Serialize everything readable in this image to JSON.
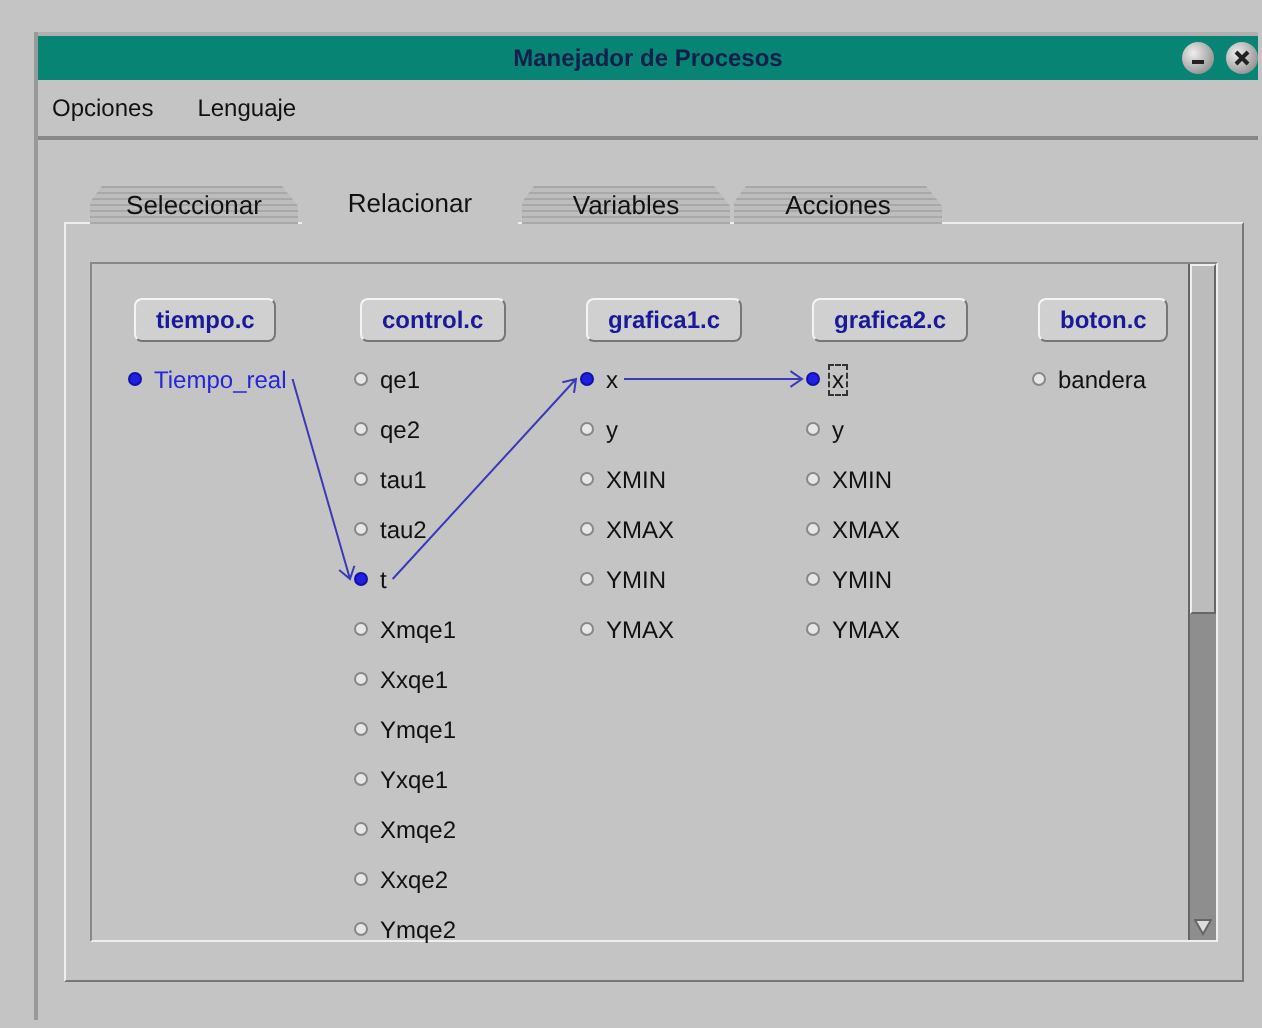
{
  "window": {
    "title": "Manejador de Procesos"
  },
  "menu": [
    "Opciones",
    "Lenguaje"
  ],
  "tabs": [
    {
      "label": "Seleccionar",
      "selected": false
    },
    {
      "label": "Relacionar",
      "selected": true
    },
    {
      "label": "Variables",
      "selected": false
    },
    {
      "label": "Acciones",
      "selected": false
    }
  ],
  "modules": [
    {
      "name": "tiempo.c",
      "variables": [
        {
          "name": "Tiempo_real",
          "connected": true,
          "selected": true,
          "focused": false,
          "links_out": true,
          "links_in": false
        }
      ]
    },
    {
      "name": "control.c",
      "variables": [
        {
          "name": "qe1",
          "connected": false,
          "selected": false,
          "focused": false
        },
        {
          "name": "qe2",
          "connected": false,
          "selected": false,
          "focused": false
        },
        {
          "name": "tau1",
          "connected": false,
          "selected": false,
          "focused": false
        },
        {
          "name": "tau2",
          "connected": false,
          "selected": false,
          "focused": false
        },
        {
          "name": "t",
          "connected": true,
          "selected": false,
          "focused": false,
          "links_out": true,
          "links_in": true
        },
        {
          "name": "Xmqe1",
          "connected": false,
          "selected": false,
          "focused": false
        },
        {
          "name": "Xxqe1",
          "connected": false,
          "selected": false,
          "focused": false
        },
        {
          "name": "Ymqe1",
          "connected": false,
          "selected": false,
          "focused": false
        },
        {
          "name": "Yxqe1",
          "connected": false,
          "selected": false,
          "focused": false
        },
        {
          "name": "Xmqe2",
          "connected": false,
          "selected": false,
          "focused": false
        },
        {
          "name": "Xxqe2",
          "connected": false,
          "selected": false,
          "focused": false
        },
        {
          "name": "Ymqe2",
          "connected": false,
          "selected": false,
          "focused": false
        }
      ]
    },
    {
      "name": "grafica1.c",
      "variables": [
        {
          "name": "x",
          "connected": true,
          "selected": false,
          "focused": false,
          "links_out": true,
          "links_in": true
        },
        {
          "name": "y",
          "connected": false,
          "selected": false,
          "focused": false
        },
        {
          "name": "XMIN",
          "connected": false,
          "selected": false,
          "focused": false
        },
        {
          "name": "XMAX",
          "connected": false,
          "selected": false,
          "focused": false
        },
        {
          "name": "YMIN",
          "connected": false,
          "selected": false,
          "focused": false
        },
        {
          "name": "YMAX",
          "connected": false,
          "selected": false,
          "focused": false
        }
      ]
    },
    {
      "name": "grafica2.c",
      "variables": [
        {
          "name": "x",
          "connected": true,
          "selected": false,
          "focused": true,
          "links_out": false,
          "links_in": true
        },
        {
          "name": "y",
          "connected": false,
          "selected": false,
          "focused": false
        },
        {
          "name": "XMIN",
          "connected": false,
          "selected": false,
          "focused": false
        },
        {
          "name": "XMAX",
          "connected": false,
          "selected": false,
          "focused": false
        },
        {
          "name": "YMIN",
          "connected": false,
          "selected": false,
          "focused": false
        },
        {
          "name": "YMAX",
          "connected": false,
          "selected": false,
          "focused": false
        }
      ]
    },
    {
      "name": "boton.c",
      "variables": [
        {
          "name": "bandera",
          "connected": false,
          "selected": false,
          "focused": false
        }
      ]
    }
  ]
}
